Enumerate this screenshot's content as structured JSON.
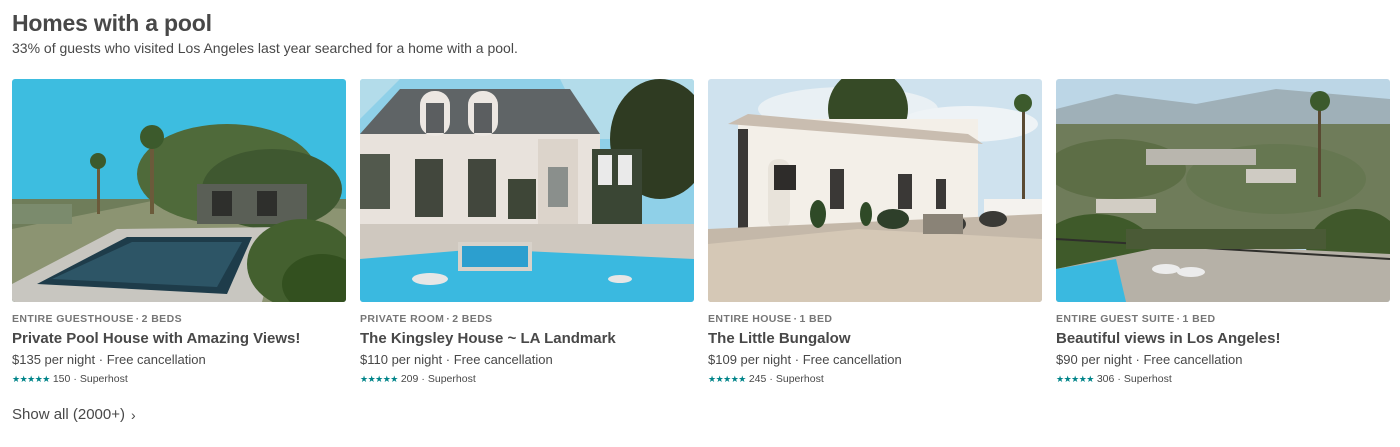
{
  "section": {
    "title": "Homes with a pool",
    "subtitle": "33% of guests who visited Los Angeles last year searched for a home with a pool."
  },
  "listings": [
    {
      "type": "ENTIRE GUESTHOUSE",
      "beds": "2 BEDS",
      "name": "Private Pool House with Amazing Views!",
      "price": "$135 per night",
      "cancellation": "Free cancellation",
      "stars": "★★★★★",
      "reviews": "150",
      "badge": "Superhost",
      "photo": "pool-house-photo"
    },
    {
      "type": "PRIVATE ROOM",
      "beds": "2 BEDS",
      "name": "The Kingsley House ~ LA Landmark",
      "price": "$110 per night",
      "cancellation": "Free cancellation",
      "stars": "★★★★★",
      "reviews": "209",
      "badge": "Superhost",
      "photo": "manor-pool-photo"
    },
    {
      "type": "ENTIRE HOUSE",
      "beds": "1 BED",
      "name": "The Little Bungalow",
      "price": "$109 per night",
      "cancellation": "Free cancellation",
      "stars": "★★★★★",
      "reviews": "245",
      "badge": "Superhost",
      "photo": "bungalow-patio-photo"
    },
    {
      "type": "ENTIRE GUEST SUITE",
      "beds": "1 BED",
      "name": "Beautiful views in Los Angeles!",
      "price": "$90 per night",
      "cancellation": "Free cancellation",
      "stars": "★★★★★",
      "reviews": "306",
      "badge": "Superhost",
      "photo": "city-view-photo"
    }
  ],
  "footer": {
    "show_all": "Show all (2000+)",
    "chevron": "›"
  },
  "colors": {
    "text": "#484848",
    "muted": "#767676",
    "stars": "#008489"
  }
}
